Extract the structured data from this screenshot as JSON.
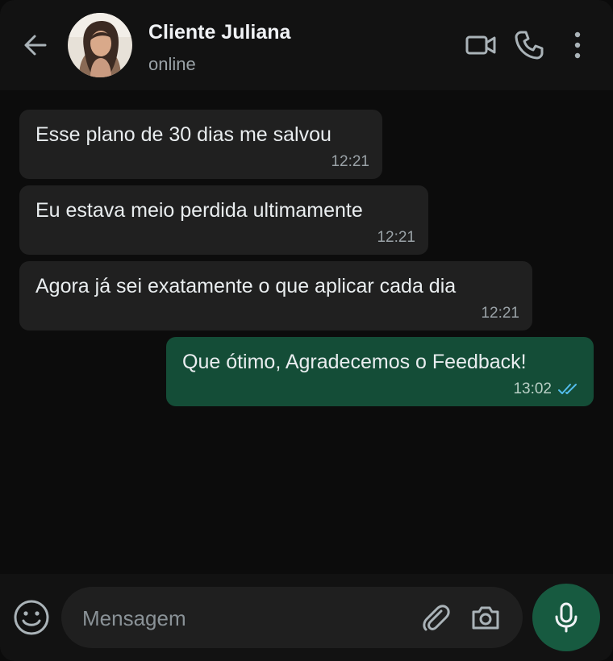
{
  "header": {
    "contact_name": "Cliente Juliana",
    "status": "online",
    "icons": [
      "back-arrow-icon",
      "video-call-icon",
      "phone-icon",
      "more-vertical-icon"
    ]
  },
  "messages": [
    {
      "direction": "incoming",
      "text": "Esse plano de 30 dias me salvou",
      "time": "12:21"
    },
    {
      "direction": "incoming",
      "text": "Eu estava meio perdida ultimamente",
      "time": "12:21"
    },
    {
      "direction": "incoming",
      "text": "Agora já sei exatamente o que aplicar cada dia",
      "time": "12:21"
    },
    {
      "direction": "outgoing",
      "text": "Que ótimo, Agradecemos o Feedback!",
      "time": "13:02",
      "read": true
    }
  ],
  "composer": {
    "placeholder": "Mensagem",
    "icons": [
      "emoji-icon",
      "paperclip-icon",
      "camera-icon",
      "mic-icon"
    ]
  },
  "colors": {
    "incoming_bubble": "#202020",
    "outgoing_bubble": "#144d37",
    "mic_button": "#175a40",
    "read_receipt": "#53bdeb"
  }
}
